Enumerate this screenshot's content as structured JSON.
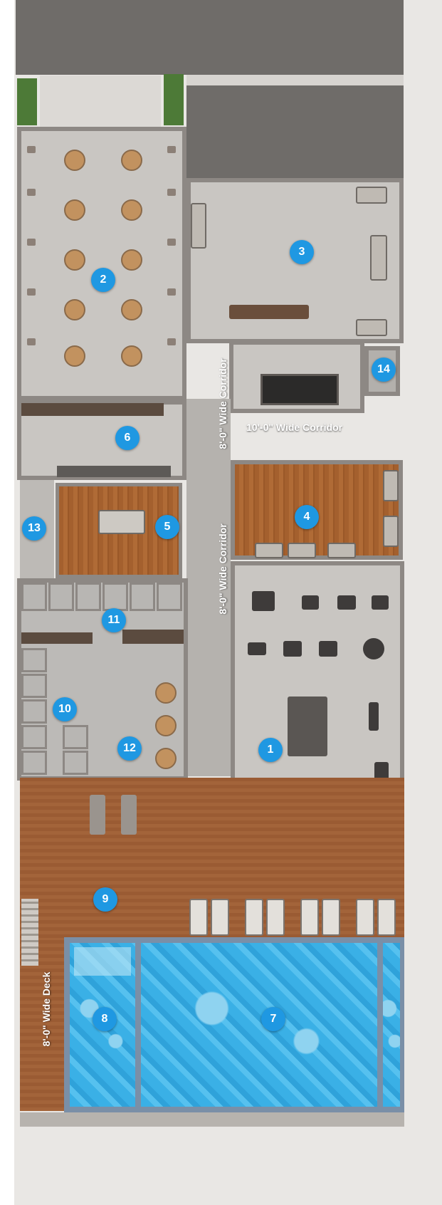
{
  "rooms": [
    {
      "number": "1"
    },
    {
      "number": "2"
    },
    {
      "number": "3"
    },
    {
      "number": "4"
    },
    {
      "number": "5"
    },
    {
      "number": "6"
    },
    {
      "number": "7"
    },
    {
      "number": "8"
    },
    {
      "number": "9"
    },
    {
      "number": "10"
    },
    {
      "number": "11"
    },
    {
      "number": "12"
    },
    {
      "number": "13"
    },
    {
      "number": "14"
    }
  ],
  "labels": {
    "corridor_8ft_upper": "8'-0\" Wide Corridor",
    "corridor_8ft_lower": "8'-0\" Wide Corridor",
    "corridor_10ft": "10'-0\" Wide Corridor",
    "deck_8ft": "8'-0\" Wide Deck"
  },
  "colors": {
    "badge": "#1f98e2",
    "pool_water": "#3ab0e6",
    "deck_wood": "#a3643a",
    "floor_concrete": "#c9c6c2",
    "walls": "#8d8884"
  }
}
